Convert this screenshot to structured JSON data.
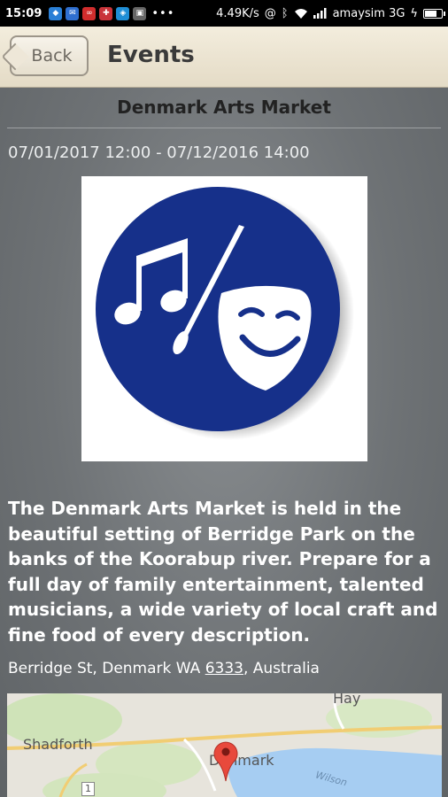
{
  "status_bar": {
    "time": "15:09",
    "dots": "•••",
    "network_speed": "4.49K/s",
    "carrier": "amaysim 3G",
    "battery_level": 0.75,
    "icons": [
      "app-icon-blue",
      "mail-icon",
      "infinity-icon",
      "app-icon-red",
      "app-icon-blue-2",
      "app-icon-grey",
      "at-icon",
      "bluetooth-icon",
      "wifi-icon",
      "signal-icon",
      "charging-icon",
      "battery-icon"
    ]
  },
  "header": {
    "back_label": "Back",
    "title": "Events"
  },
  "event": {
    "name": "Denmark Arts Market",
    "dates": "07/01/2017 12:00 - 07/12/2016 14:00",
    "description": "The Denmark Arts Market is held in the beautiful setting of Berridge Park on the banks of the Koorabup river. Prepare for a full day of family entertainment, talented musicians, a wide variety of local craft and fine food of every description.",
    "address_before": "Berridge St, Denmark WA ",
    "address_postcode": "6333",
    "address_after": ", Australia"
  },
  "map": {
    "labels": {
      "hay": "Hay",
      "shadforth": "Shadforth",
      "denmark": "Denmark",
      "route": "1",
      "water": "Wilson"
    }
  },
  "colors": {
    "logo_circle": "#16308a",
    "marker": "#e8493c"
  }
}
